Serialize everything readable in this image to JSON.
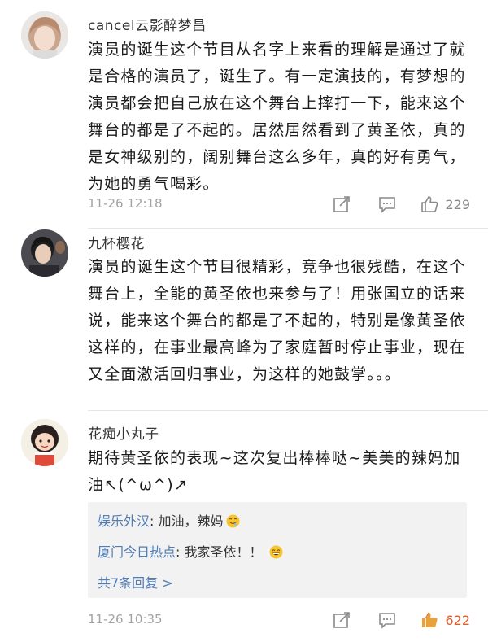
{
  "comments": [
    {
      "username": "cancel云影醉梦昌",
      "text": "演员的诞生这个节目从名字上来看的理解是通过了就是合格的演员了，诞生了。有一定演技的，有梦想的演员都会把自己放在这个舞台上摔打一下，能来这个舞台的都是了不起的。居然居然看到了黄圣依，真的是女神级别的，阔别舞台这么多年，真的好有勇气，为她的勇气喝彩。",
      "timestamp": "11-26 12:18",
      "likes": "229"
    },
    {
      "username": "九杯樱花",
      "text": "演员的诞生这个节目很精彩，竞争也很残酷，在这个舞台上，全能的黄圣依也来参与了！用张国立的话来说，能来这个舞台的都是了不起的，特别是像黄圣依这样的，在事业最高峰为了家庭暂时停止事业，现在又全面激活回归事业，为这样的她鼓掌。。。",
      "timestamp": "",
      "likes": ""
    },
    {
      "username": "花痴小丸子",
      "text": "期待黄圣依的表现~这次复出棒棒哒~美美的辣妈加油↖(^ω^)↗",
      "timestamp": "11-26 10:35",
      "likes": "622",
      "replies": [
        {
          "user": "娱乐外汉",
          "text": ": 加油，辣妈",
          "emoji": "drooling-face-icon"
        },
        {
          "user": "厦门今日热点",
          "text": ": 我家圣依！！",
          "emoji": "grinning-face-icon"
        }
      ],
      "more_replies": "共7条回复 >"
    }
  ],
  "colors": {
    "link": "#4f7db8",
    "like_hot": "#e05d2c",
    "meta": "#a2a2a2"
  }
}
